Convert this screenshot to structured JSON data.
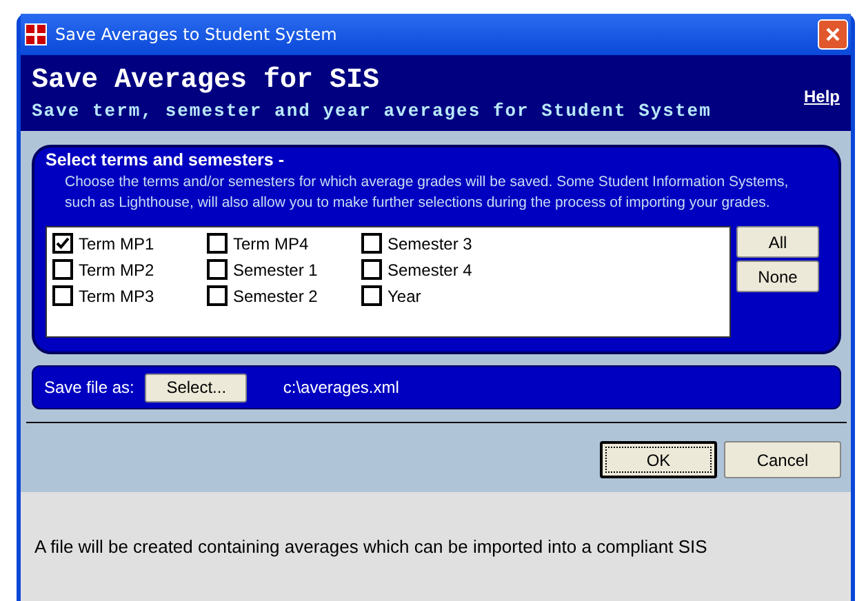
{
  "window": {
    "title": "Save Averages to Student System"
  },
  "header": {
    "title": "Save Averages for SIS",
    "subtitle": "Save term, semester and year averages for Student System",
    "help_link": "Help"
  },
  "selection": {
    "title": "Select terms and semesters -",
    "description": "Choose the terms and/or semesters for which average grades will be saved.  Some Student Information Systems, such as Lighthouse, will also allow you to make further selections during the process of importing your grades.",
    "options": [
      {
        "label": "Term MP1",
        "checked": true
      },
      {
        "label": "Term MP2",
        "checked": false
      },
      {
        "label": "Term MP3",
        "checked": false
      },
      {
        "label": "Term MP4",
        "checked": false
      },
      {
        "label": "Semester 1",
        "checked": false
      },
      {
        "label": "Semester 2",
        "checked": false
      },
      {
        "label": "Semester 3",
        "checked": false
      },
      {
        "label": "Semester 4",
        "checked": false
      },
      {
        "label": "Year",
        "checked": false
      }
    ],
    "buttons": [
      "All",
      "None"
    ]
  },
  "save_file": {
    "label": "Save file as:",
    "button": "Select...",
    "path": "c:\\averages.xml"
  },
  "buttons": [
    {
      "label": "OK",
      "default": true
    },
    {
      "label": "Cancel",
      "default": false
    }
  ],
  "status": "A file will be created containing averages which can be imported into a compliant SIS"
}
